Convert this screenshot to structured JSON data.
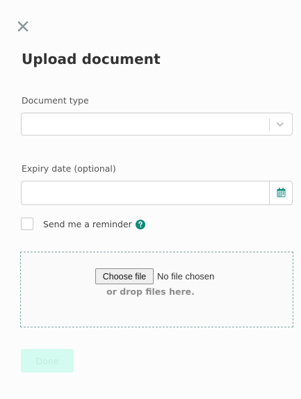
{
  "header": {
    "close_icon": "close-icon",
    "title": "Upload document"
  },
  "form": {
    "document_type": {
      "label": "Document type",
      "value": "",
      "icon": "chevron-down-icon"
    },
    "expiry_date": {
      "label": "Expiry date (optional)",
      "value": "",
      "icon": "calendar-icon"
    },
    "reminder": {
      "label": "Send me a reminder",
      "checked": false,
      "help_icon": "help-icon"
    },
    "upload": {
      "choose_button": "Choose file",
      "no_file_text": "No file chosen",
      "drop_text": "or drop files here."
    }
  },
  "footer": {
    "done_label": "Done"
  },
  "colors": {
    "accent": "#0f8a7a",
    "done_bg": "#d4fbf0",
    "dropzone_border": "#7fa6a3"
  }
}
